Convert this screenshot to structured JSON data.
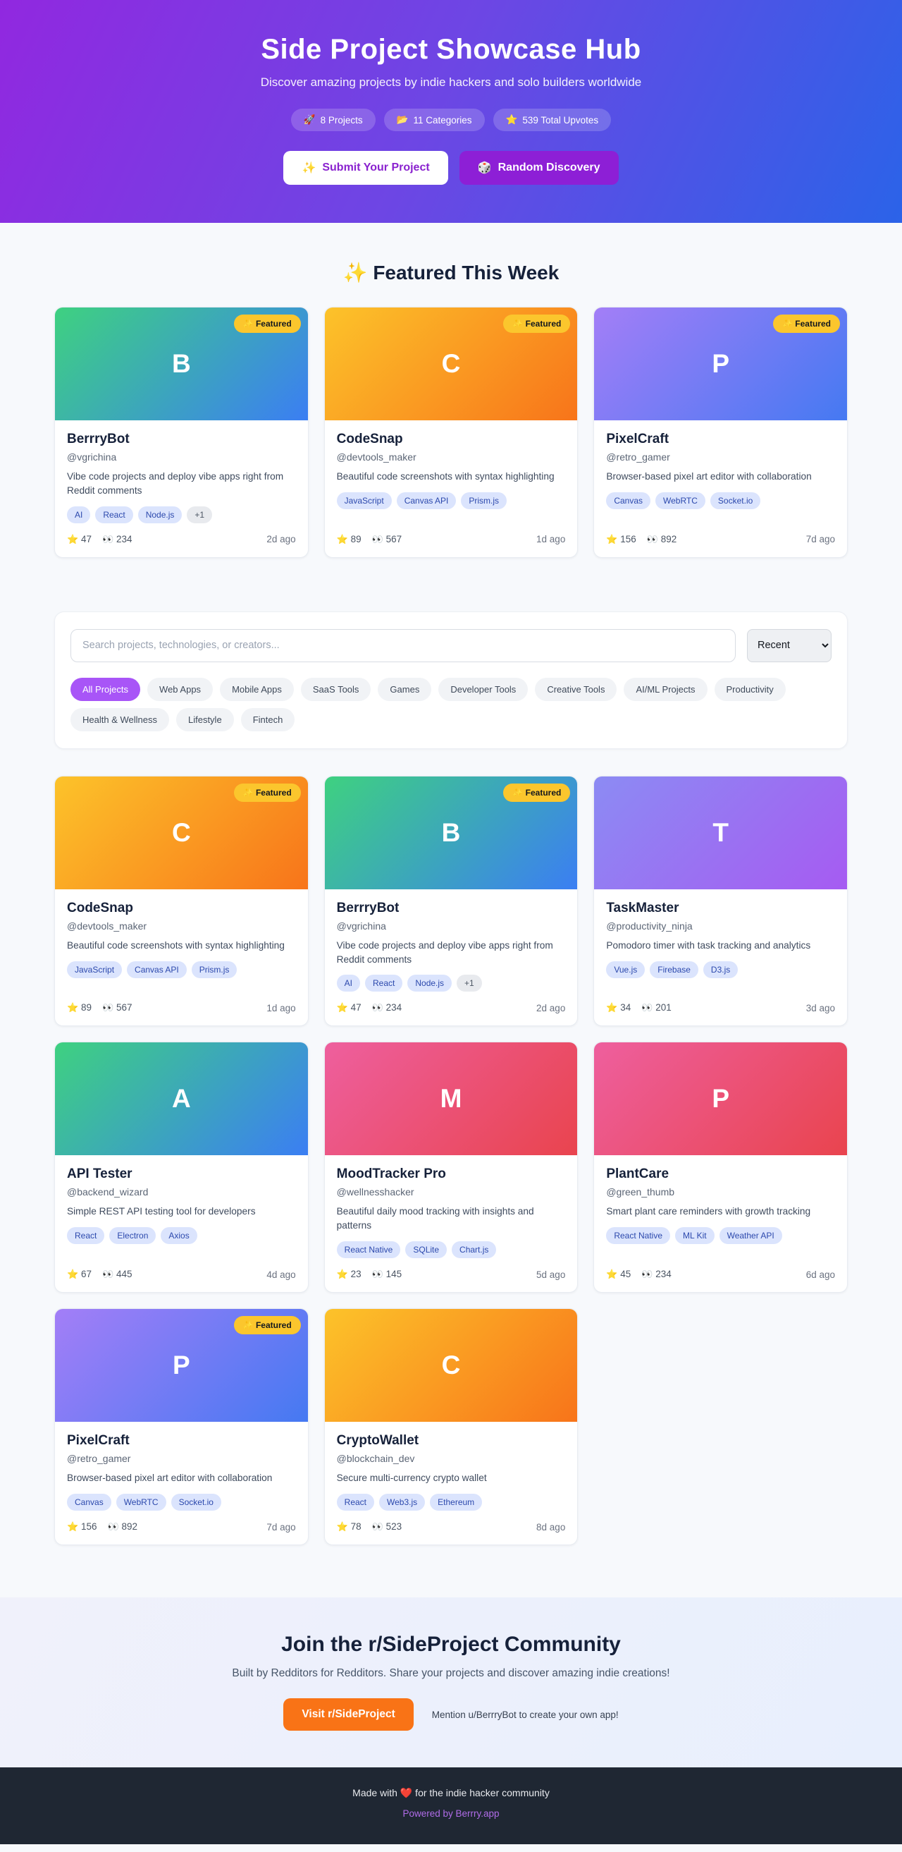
{
  "colors": {
    "header_gradient": [
      "#9128e0",
      "#2b63e8"
    ],
    "accent_purple": "#a855f7",
    "accent_orange": "#f97316",
    "badge_yellow": "#fbc62d",
    "tag_bg": "#dbe4fd",
    "tag_text": "#2c49ad",
    "footer_bg": "#1f2733",
    "link_purple": "#b06ce8",
    "gradients": {
      "green_blue": [
        "#3ed180",
        "#3b7ef3"
      ],
      "yellow_orange": [
        "#fcc32a",
        "#f8741a"
      ],
      "indigo_violet": [
        "#8c8bf3",
        "#a65bf2"
      ],
      "pink_red": [
        "#ee5f9e",
        "#e9444e"
      ],
      "purple_blue": [
        "#a37ef7",
        "#4579f2"
      ]
    }
  },
  "header": {
    "title": "Side Project Showcase Hub",
    "subtitle": "Discover amazing projects by indie hackers and solo builders worldwide",
    "stats": [
      {
        "icon": "🚀",
        "label": "8 Projects"
      },
      {
        "icon": "📂",
        "label": "11 Categories"
      },
      {
        "icon": "⭐",
        "label": "539 Total Upvotes"
      }
    ],
    "submit_button": {
      "icon": "✨",
      "label": "Submit Your Project"
    },
    "random_button": {
      "icon": "🎲",
      "label": "Random Discovery"
    }
  },
  "featured_section": {
    "icon": "✨",
    "heading": "Featured This Week"
  },
  "badge_label": "✨ Featured",
  "icons": {
    "star": "⭐",
    "views": "👀",
    "favorite": "🤍"
  },
  "search": {
    "placeholder": "Search projects, technologies, or creators...",
    "sort_selected": "Recent"
  },
  "filters": [
    {
      "label": "All Projects",
      "active": true
    },
    {
      "label": "Web Apps",
      "active": false
    },
    {
      "label": "Mobile Apps",
      "active": false
    },
    {
      "label": "SaaS Tools",
      "active": false
    },
    {
      "label": "Games",
      "active": false
    },
    {
      "label": "Developer Tools",
      "active": false
    },
    {
      "label": "Creative Tools",
      "active": false
    },
    {
      "label": "AI/ML Projects",
      "active": false
    },
    {
      "label": "Productivity",
      "active": false
    },
    {
      "label": "Health & Wellness",
      "active": false
    },
    {
      "label": "Lifestyle",
      "active": false
    },
    {
      "label": "Fintech",
      "active": false
    }
  ],
  "featured_projects": [
    {
      "letter": "B",
      "gradient": "green_blue",
      "featured": true,
      "title": "BerrryBot",
      "handle": "@vgrichina",
      "description": "Vibe code projects and deploy vibe apps right from Reddit comments",
      "tags": [
        "AI",
        "React",
        "Node.js"
      ],
      "extra_tag": "+1",
      "stars": "47",
      "views": "234",
      "age": "2d ago"
    },
    {
      "letter": "C",
      "gradient": "yellow_orange",
      "featured": true,
      "title": "CodeSnap",
      "handle": "@devtools_maker",
      "description": "Beautiful code screenshots with syntax highlighting",
      "tags": [
        "JavaScript",
        "Canvas API",
        "Prism.js"
      ],
      "stars": "89",
      "views": "567",
      "age": "1d ago"
    },
    {
      "letter": "P",
      "gradient": "purple_blue",
      "featured": true,
      "title": "PixelCraft",
      "handle": "@retro_gamer",
      "description": "Browser-based pixel art editor with collaboration",
      "tags": [
        "Canvas",
        "WebRTC",
        "Socket.io"
      ],
      "stars": "156",
      "views": "892",
      "age": "7d ago"
    }
  ],
  "projects": [
    {
      "letter": "C",
      "gradient": "yellow_orange",
      "featured": true,
      "title": "CodeSnap",
      "handle": "@devtools_maker",
      "description": "Beautiful code screenshots with syntax highlighting",
      "tags": [
        "JavaScript",
        "Canvas API",
        "Prism.js"
      ],
      "stars": "89",
      "views": "567",
      "age": "1d ago"
    },
    {
      "letter": "B",
      "gradient": "green_blue",
      "featured": true,
      "title": "BerrryBot",
      "handle": "@vgrichina",
      "description": "Vibe code projects and deploy vibe apps right from Reddit comments",
      "tags": [
        "AI",
        "React",
        "Node.js"
      ],
      "extra_tag": "+1",
      "stars": "47",
      "views": "234",
      "age": "2d ago"
    },
    {
      "letter": "T",
      "gradient": "indigo_violet",
      "featured": false,
      "title": "TaskMaster",
      "handle": "@productivity_ninja",
      "description": "Pomodoro timer with task tracking and analytics",
      "tags": [
        "Vue.js",
        "Firebase",
        "D3.js"
      ],
      "stars": "34",
      "views": "201",
      "age": "3d ago"
    },
    {
      "letter": "A",
      "gradient": "green_blue",
      "featured": false,
      "title": "API Tester",
      "handle": "@backend_wizard",
      "description": "Simple REST API testing tool for developers",
      "tags": [
        "React",
        "Electron",
        "Axios"
      ],
      "stars": "67",
      "views": "445",
      "age": "4d ago"
    },
    {
      "letter": "M",
      "gradient": "pink_red",
      "featured": false,
      "title": "MoodTracker Pro",
      "handle": "@wellnesshacker",
      "description": "Beautiful daily mood tracking with insights and patterns",
      "tags": [
        "React Native",
        "SQLite",
        "Chart.js"
      ],
      "stars": "23",
      "views": "145",
      "age": "5d ago"
    },
    {
      "letter": "P",
      "gradient": "pink_red",
      "featured": false,
      "title": "PlantCare",
      "handle": "@green_thumb",
      "description": "Smart plant care reminders with growth tracking",
      "tags": [
        "React Native",
        "ML Kit",
        "Weather API"
      ],
      "stars": "45",
      "views": "234",
      "age": "6d ago"
    },
    {
      "letter": "P",
      "gradient": "purple_blue",
      "featured": true,
      "title": "PixelCraft",
      "handle": "@retro_gamer",
      "description": "Browser-based pixel art editor with collaboration",
      "tags": [
        "Canvas",
        "WebRTC",
        "Socket.io"
      ],
      "stars": "156",
      "views": "892",
      "age": "7d ago"
    },
    {
      "letter": "C",
      "gradient": "yellow_orange",
      "featured": false,
      "title": "CryptoWallet",
      "handle": "@blockchain_dev",
      "description": "Secure multi-currency crypto wallet",
      "tags": [
        "React",
        "Web3.js",
        "Ethereum"
      ],
      "stars": "78",
      "views": "523",
      "age": "8d ago"
    }
  ],
  "cta": {
    "heading": "Join the r/SideProject Community",
    "subtitle": "Built by Redditors for Redditors. Share your projects and discover amazing indie creations!",
    "button": "Visit r/SideProject",
    "note": "Mention u/BerrryBot to create your own app!"
  },
  "footer": {
    "line1": "Made with ❤️ for the indie hacker community",
    "link": "Powered by Berrry.app"
  }
}
